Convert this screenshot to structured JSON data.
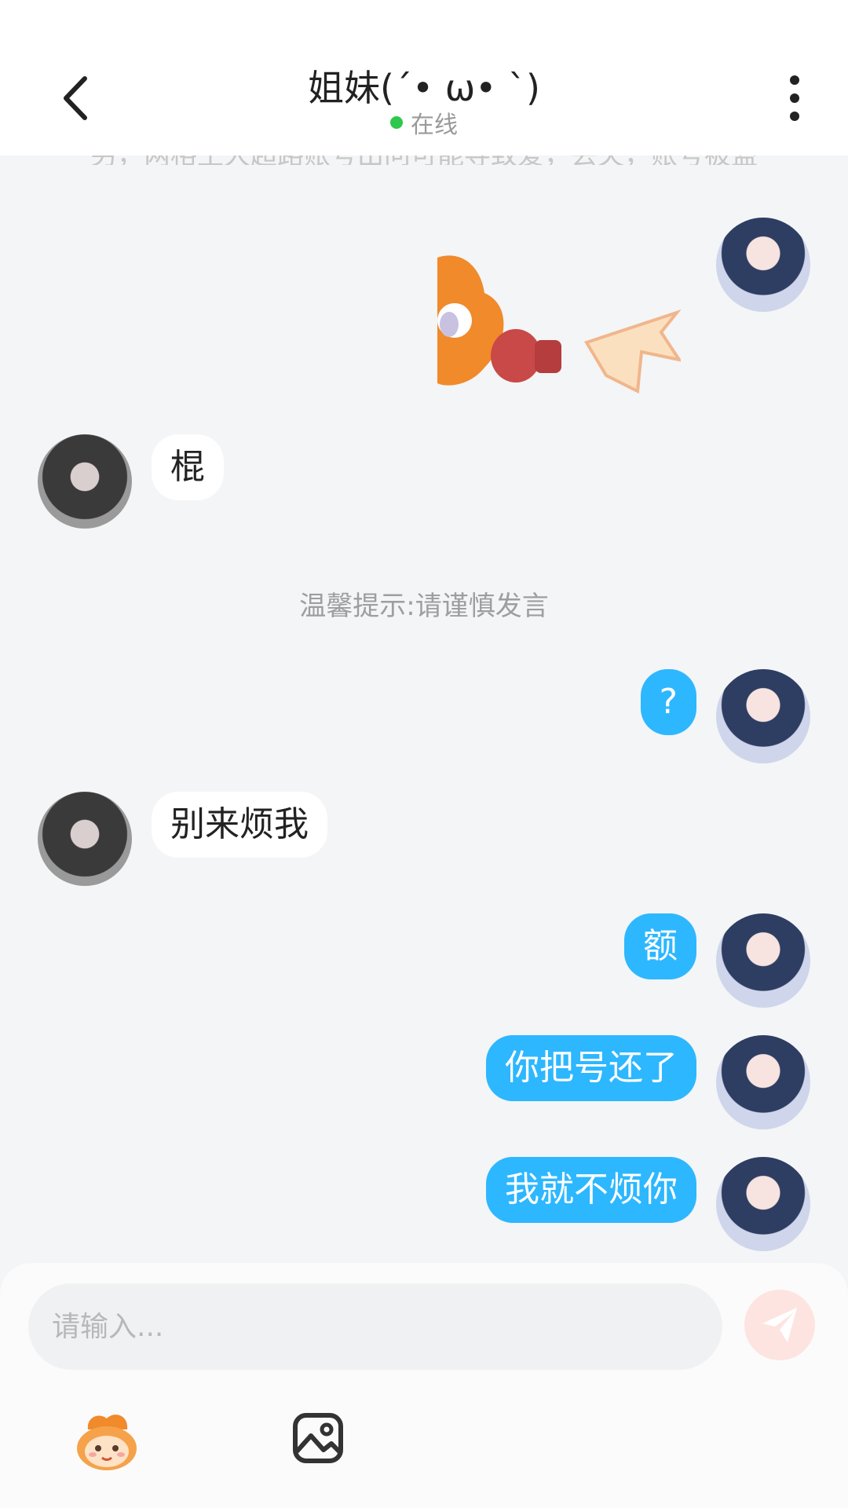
{
  "header": {
    "title": "姐妹(´• ω• `)",
    "status": "在线"
  },
  "chat": {
    "truncated_text": "另，两格土大超路账号出问可能导致爱，丢失，账号被盗",
    "hint": "温馨提示:请谨慎发言",
    "messages": [
      {
        "side": "left",
        "text": "棍"
      },
      {
        "side": "right",
        "text": "?"
      },
      {
        "side": "left",
        "text": "别来烦我"
      },
      {
        "side": "right",
        "text": "额"
      },
      {
        "side": "right",
        "text": "你把号还了"
      },
      {
        "side": "right",
        "text": "我就不烦你"
      }
    ]
  },
  "input": {
    "placeholder": "请输入..."
  },
  "icons": {
    "back": "chevron-left-icon",
    "more": "more-vertical-icon",
    "send": "send-icon",
    "emoji": "emoji-mascot-icon",
    "image": "image-icon"
  },
  "colors": {
    "bubble_right": "#2db7ff",
    "bubble_left": "#ffffff",
    "background": "#f3f5f7",
    "online": "#2dc84d"
  }
}
